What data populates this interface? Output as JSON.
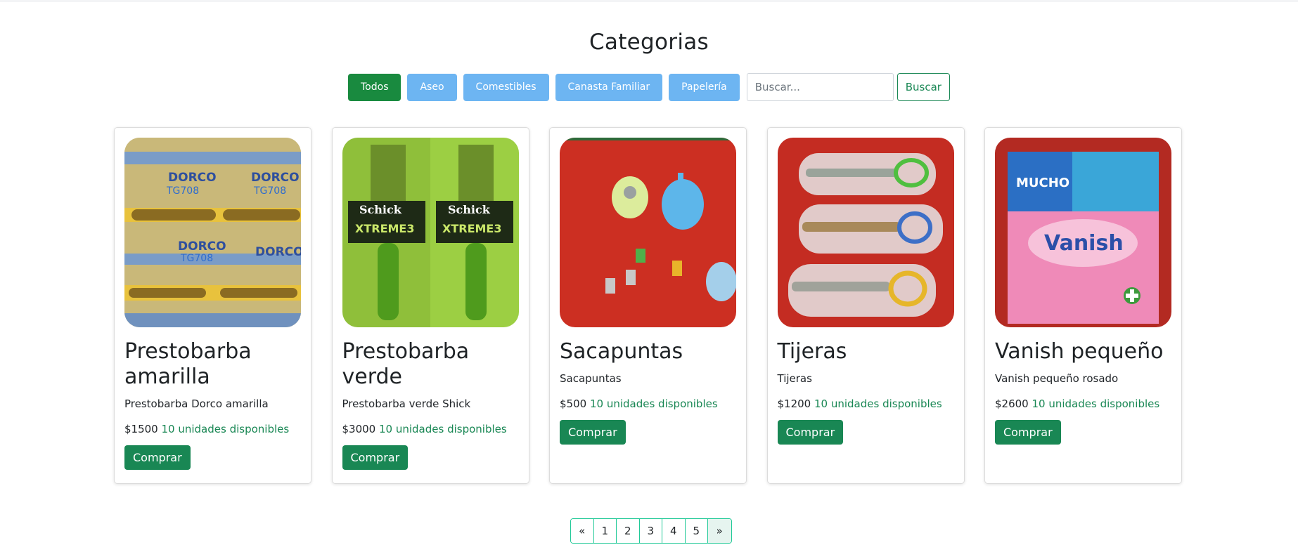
{
  "title": "Categorias",
  "filters": {
    "categories": [
      {
        "label": "Todos",
        "active": true
      },
      {
        "label": "Aseo",
        "active": false
      },
      {
        "label": "Comestibles",
        "active": false
      },
      {
        "label": "Canasta Familiar",
        "active": false
      },
      {
        "label": "Papelería",
        "active": false
      }
    ],
    "search_placeholder": "Buscar...",
    "search_value": "",
    "search_button": "Buscar"
  },
  "products": [
    {
      "name": "Prestobarba amarilla",
      "description": "Prestobarba Dorco amarilla",
      "price": "$1500",
      "stock": "10 unidades disponibles",
      "buy": "Comprar",
      "image": "dorco-yellow-razors"
    },
    {
      "name": "Prestobarba verde",
      "description": "Prestobarba verde Shick",
      "price": "$3000",
      "stock": "10 unidades disponibles",
      "buy": "Comprar",
      "image": "schick-green-razors"
    },
    {
      "name": "Sacapuntas",
      "description": "Sacapuntas",
      "price": "$500",
      "stock": "10 unidades disponibles",
      "buy": "Comprar",
      "image": "sharpeners-on-red"
    },
    {
      "name": "Tijeras",
      "description": "Tijeras",
      "price": "$1200",
      "stock": "10 unidades disponibles",
      "buy": "Comprar",
      "image": "scissors-on-red"
    },
    {
      "name": "Vanish pequeño",
      "description": "Vanish pequeño rosado",
      "price": "$2600",
      "stock": "10 unidades disponibles",
      "buy": "Comprar",
      "image": "vanish-pink-sachet"
    }
  ],
  "pagination": {
    "prev": "«",
    "pages": [
      "1",
      "2",
      "3",
      "4",
      "5"
    ],
    "next": "»"
  },
  "image_text": {
    "dorco_brand": "DORCO",
    "dorco_model": "TG708",
    "schick_brand": "Schick",
    "schick_line": "XTREME3",
    "vanish_brand": "Vanish",
    "vanish_tag": "MUCHO"
  },
  "colors": {
    "active_filter": "#198a3f",
    "inactive_filter": "#6db5f2",
    "primary_green": "#198754"
  }
}
